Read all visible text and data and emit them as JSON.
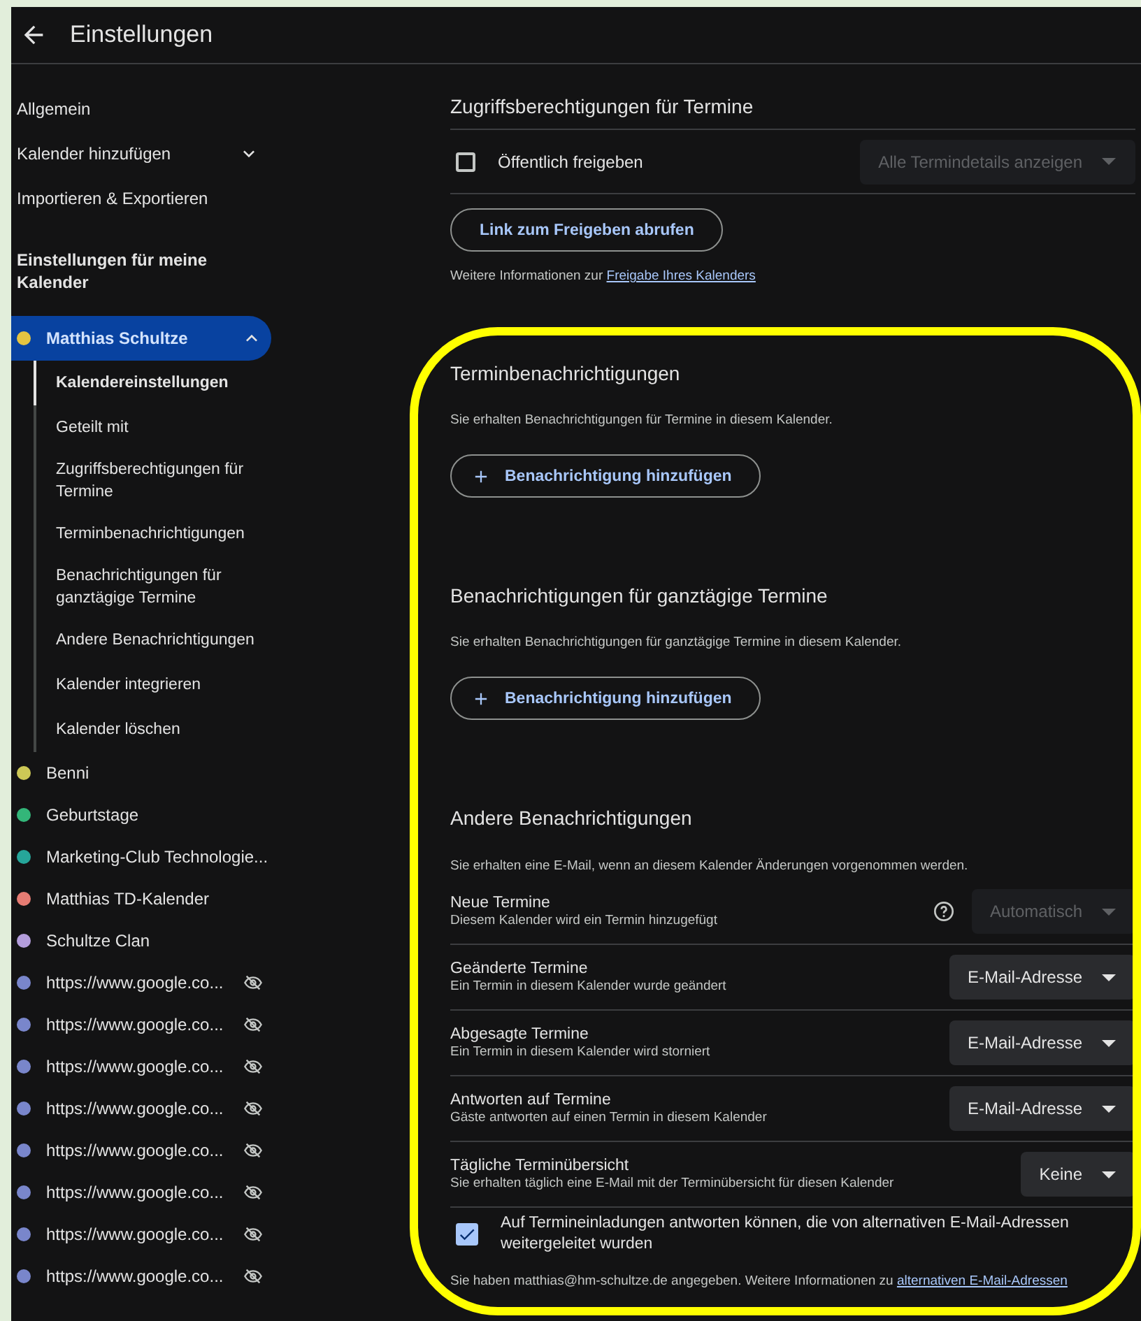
{
  "header": {
    "title": "Einstellungen"
  },
  "sidebar": {
    "items": [
      {
        "label": "Allgemein",
        "kind": "link"
      },
      {
        "label": "Kalender hinzufügen",
        "kind": "dropdown"
      },
      {
        "label": "Importieren & Exportieren",
        "kind": "link"
      }
    ],
    "heading": "Einstellungen für meine Kalender",
    "calendars": [
      {
        "label": "Matthias Schultze",
        "color": "#e4c441",
        "selected": true,
        "expanded": true,
        "hidden": false,
        "subitems": [
          {
            "label": "Kalendereinstellungen",
            "selected": true
          },
          {
            "label": "Geteilt mit",
            "selected": false
          },
          {
            "label": "Zugriffsberechtigungen für Termine",
            "selected": false
          },
          {
            "label": "Terminbenachrichtigungen",
            "selected": false
          },
          {
            "label": "Benachrichtigungen für ganztägige Termine",
            "selected": false
          },
          {
            "label": "Andere Benachrichtigungen",
            "selected": false
          },
          {
            "label": "Kalender integrieren",
            "selected": false
          },
          {
            "label": "Kalender löschen",
            "selected": false
          }
        ]
      },
      {
        "label": "Benni",
        "color": "#cdc856",
        "selected": false,
        "hidden": false
      },
      {
        "label": "Geburtstage",
        "color": "#33b679",
        "selected": false,
        "hidden": false
      },
      {
        "label": "Marketing-Club Technologie...",
        "color": "#26a69a",
        "selected": false,
        "hidden": false
      },
      {
        "label": "Matthias TD-Kalender",
        "color": "#e67c73",
        "selected": false,
        "hidden": false
      },
      {
        "label": "Schultze Clan",
        "color": "#b39ddb",
        "selected": false,
        "hidden": false
      },
      {
        "label": "https://www.google.co...",
        "color": "#7986cb",
        "selected": false,
        "hidden": true
      },
      {
        "label": "https://www.google.co...",
        "color": "#7986cb",
        "selected": false,
        "hidden": true
      },
      {
        "label": "https://www.google.co...",
        "color": "#7986cb",
        "selected": false,
        "hidden": true
      },
      {
        "label": "https://www.google.co...",
        "color": "#7986cb",
        "selected": false,
        "hidden": true
      },
      {
        "label": "https://www.google.co...",
        "color": "#7986cb",
        "selected": false,
        "hidden": true
      },
      {
        "label": "https://www.google.co...",
        "color": "#7986cb",
        "selected": false,
        "hidden": true
      },
      {
        "label": "https://www.google.co...",
        "color": "#7986cb",
        "selected": false,
        "hidden": true
      },
      {
        "label": "https://www.google.co...",
        "color": "#7986cb",
        "selected": false,
        "hidden": true
      }
    ]
  },
  "access": {
    "title": "Zugriffsberechtigungen für Termine",
    "public": {
      "label": "Öffentlich freigeben",
      "checked": false
    },
    "detail_select": {
      "value": "Alle Termindetails anzeigen",
      "disabled": true
    },
    "link_button": "Link zum Freigeben abrufen",
    "info": "Weitere Informationen zur",
    "info_link": "Freigabe Ihres Kalenders"
  },
  "event_notifications": {
    "title": "Terminbenachrichtigungen",
    "description": "Sie erhalten Benachrichtigungen für Termine in diesem Kalender.",
    "add_button": "Benachrichtigung hinzufügen"
  },
  "allday_notifications": {
    "title": "Benachrichtigungen für ganztägige Termine",
    "description": "Sie erhalten Benachrichtigungen für ganztägige Termine in diesem Kalender.",
    "add_button": "Benachrichtigung hinzufügen"
  },
  "other": {
    "title": "Andere Benachrichtigungen",
    "description": "Sie erhalten eine E-Mail, wenn an diesem Kalender Änderungen vorgenommen werden.",
    "rows": [
      {
        "title": "Neue Termine",
        "subtitle": "Diesem Kalender wird ein Termin hinzugefügt",
        "value": "Automatisch",
        "disabled": true,
        "help": true
      },
      {
        "title": "Geänderte Termine",
        "subtitle": "Ein Termin in diesem Kalender wurde geändert",
        "value": "E-Mail-Adresse",
        "disabled": false,
        "help": false
      },
      {
        "title": "Abgesagte Termine",
        "subtitle": "Ein Termin in diesem Kalender wird storniert",
        "value": "E-Mail-Adresse",
        "disabled": false,
        "help": false
      },
      {
        "title": "Antworten auf Termine",
        "subtitle": "Gäste antworten auf einen Termin in diesem Kalender",
        "value": "E-Mail-Adresse",
        "disabled": false,
        "help": false
      },
      {
        "title": "Tägliche Terminübersicht",
        "subtitle": "Sie erhalten täglich eine E-Mail mit der Terminübersicht für diesen Kalender",
        "value": "Keine",
        "disabled": false,
        "help": false
      }
    ],
    "forward": {
      "label": "Auf Termineinladungen antworten können, die von alternativen E-Mail-Adressen weitergeleitet wurden",
      "checked": true
    },
    "footer": {
      "text": "Sie haben matthias@hm-schultze.de angegeben. Weitere Informationen zu",
      "link": "alternativen E-Mail-Adressen"
    }
  }
}
